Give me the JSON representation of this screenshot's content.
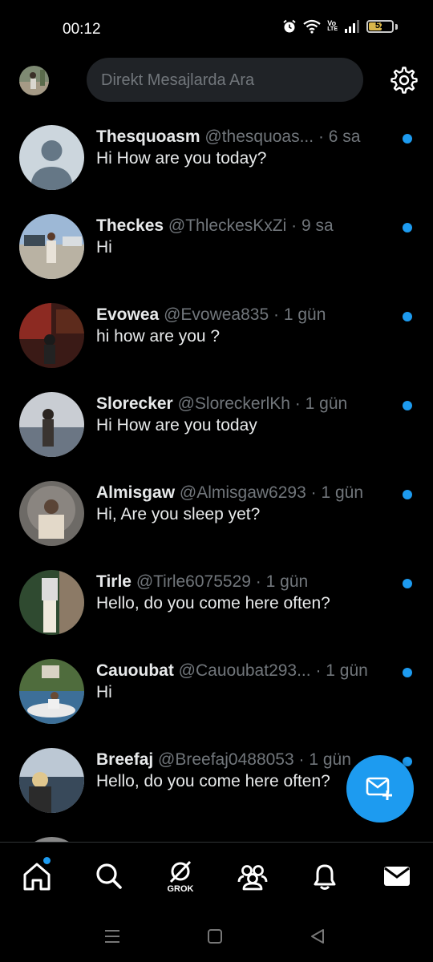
{
  "status_bar": {
    "time": "00:12",
    "battery_level": "52",
    "network_badge_top": "Vo",
    "network_badge_bottom": "LTE"
  },
  "header": {
    "search_placeholder": "Direkt Mesajlarda Ara"
  },
  "conversations": [
    {
      "name": "Thesquoasm",
      "handle": "@thesquoas...",
      "time": "6 sa",
      "preview": "Hi How are you today?",
      "unread": true
    },
    {
      "name": "Theckes",
      "handle": "@ThleckesKxZi",
      "time": "9 sa",
      "preview": "Hi",
      "unread": true
    },
    {
      "name": "Evowea",
      "handle": "@Evowea835",
      "time": "1 gün",
      "preview": "hi how are you ?",
      "unread": true
    },
    {
      "name": "Slorecker",
      "handle": "@SloreckerlKh",
      "time": "1 gün",
      "preview": "Hi How are you today",
      "unread": true
    },
    {
      "name": "Almisgaw",
      "handle": "@Almisgaw6293",
      "time": "1 gün",
      "preview": "Hi, Are you sleep yet?",
      "unread": true
    },
    {
      "name": "Tirle",
      "handle": "@Tirle6075529",
      "time": "1 gün",
      "preview": "Hello, do you come here often?",
      "unread": true
    },
    {
      "name": "Cauoubat",
      "handle": "@Cauoubat293...",
      "time": "1 gün",
      "preview": "Hi",
      "unread": true
    },
    {
      "name": "Breefaj",
      "handle": "@Breefaj0488053",
      "time": "1 gün",
      "preview": "Hello, do you come here often?",
      "unread": true
    }
  ],
  "separator": "·",
  "bottom_nav": {
    "grok_label": "GROK",
    "items": [
      "home-icon",
      "search-icon",
      "grok-icon",
      "communities-icon",
      "notifications-icon",
      "messages-icon"
    ]
  },
  "colors": {
    "accent": "#1d9bf0",
    "background": "#000000",
    "secondary_text": "#71767b",
    "search_bg": "#202327"
  }
}
